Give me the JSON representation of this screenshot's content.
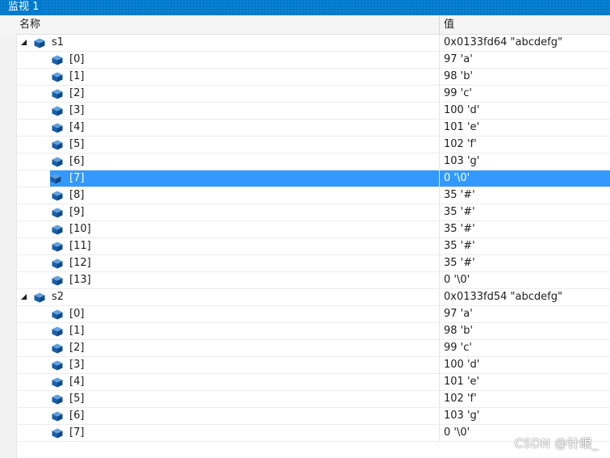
{
  "window": {
    "title": "监视 1"
  },
  "columns": {
    "name": "名称",
    "value": "值"
  },
  "rows": [
    {
      "level": 0,
      "expanded": true,
      "name": "s1",
      "value": "0x0133fd64 \"abcdefg\""
    },
    {
      "level": 1,
      "name": "[0]",
      "value": "97 'a'"
    },
    {
      "level": 1,
      "name": "[1]",
      "value": "98 'b'"
    },
    {
      "level": 1,
      "name": "[2]",
      "value": "99 'c'"
    },
    {
      "level": 1,
      "name": "[3]",
      "value": "100 'd'"
    },
    {
      "level": 1,
      "name": "[4]",
      "value": "101 'e'"
    },
    {
      "level": 1,
      "name": "[5]",
      "value": "102 'f'"
    },
    {
      "level": 1,
      "name": "[6]",
      "value": "103 'g'"
    },
    {
      "level": 1,
      "name": "[7]",
      "value": "0 '\\0'",
      "selected": true
    },
    {
      "level": 1,
      "name": "[8]",
      "value": "35 '#'"
    },
    {
      "level": 1,
      "name": "[9]",
      "value": "35 '#'"
    },
    {
      "level": 1,
      "name": "[10]",
      "value": "35 '#'"
    },
    {
      "level": 1,
      "name": "[11]",
      "value": "35 '#'"
    },
    {
      "level": 1,
      "name": "[12]",
      "value": "35 '#'"
    },
    {
      "level": 1,
      "name": "[13]",
      "value": "0 '\\0'"
    },
    {
      "level": 0,
      "expanded": true,
      "name": "s2",
      "value": "0x0133fd54 \"abcdefg\""
    },
    {
      "level": 1,
      "name": "[0]",
      "value": "97 'a'"
    },
    {
      "level": 1,
      "name": "[1]",
      "value": "98 'b'"
    },
    {
      "level": 1,
      "name": "[2]",
      "value": "99 'c'"
    },
    {
      "level": 1,
      "name": "[3]",
      "value": "100 'd'"
    },
    {
      "level": 1,
      "name": "[4]",
      "value": "101 'e'"
    },
    {
      "level": 1,
      "name": "[5]",
      "value": "102 'f'"
    },
    {
      "level": 1,
      "name": "[6]",
      "value": "103 'g'"
    },
    {
      "level": 1,
      "name": "[7]",
      "value": "0 '\\0'"
    }
  ],
  "watermark": "CSDN @针眼_",
  "colors": {
    "accent": "#007acc",
    "selection": "#3399ff",
    "icon": "#1a5fa8"
  },
  "icons": {
    "expander": "expanded-triangle-icon",
    "variable": "variable-cube-icon"
  }
}
